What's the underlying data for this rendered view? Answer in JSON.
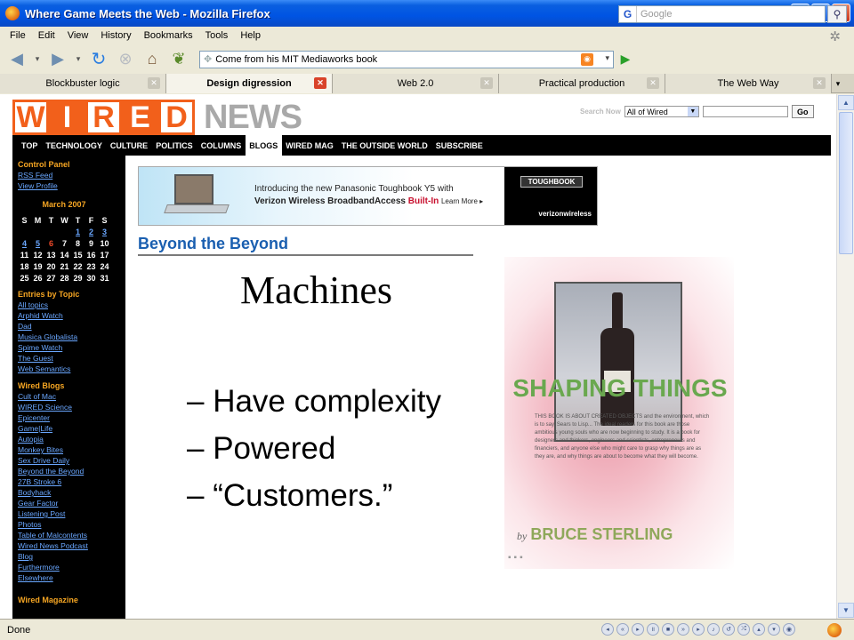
{
  "window": {
    "title": "Where Game Meets the Web - Mozilla Firefox"
  },
  "menu": {
    "items": [
      "File",
      "Edit",
      "View",
      "History",
      "Bookmarks",
      "Tools",
      "Help"
    ]
  },
  "toolbar": {
    "url": "Come from his MIT Mediaworks book",
    "search_placeholder": "Google"
  },
  "tabs": [
    {
      "label": "Blockbuster logic",
      "active": false
    },
    {
      "label": "Design digression",
      "active": true
    },
    {
      "label": "Web 2.0",
      "active": false
    },
    {
      "label": "Practical production",
      "active": false
    },
    {
      "label": "The Web Way",
      "active": false
    }
  ],
  "wired": {
    "logo_letters": [
      "W",
      "I",
      "R",
      "E",
      "D"
    ],
    "logo_news": "NEWS",
    "search_label": "Search Now",
    "search_scope": "All of Wired",
    "search_go": "Go",
    "nav": [
      "TOP",
      "TECHNOLOGY",
      "CULTURE",
      "POLITICS",
      "COLUMNS",
      "BLOGS",
      "WIRED MAG",
      "THE OUTSIDE WORLD",
      "SUBSCRIBE"
    ],
    "nav_active": "BLOGS"
  },
  "sidebar": {
    "control_panel": {
      "heading": "Control Panel",
      "links": [
        "RSS Feed",
        "View Profile"
      ]
    },
    "calendar": {
      "month": "March 2007",
      "weekdays": [
        "S",
        "M",
        "T",
        "W",
        "T",
        "F",
        "S"
      ],
      "weeks": [
        [
          "",
          "",
          "",
          "",
          "1",
          "2",
          "3"
        ],
        [
          "4",
          "5",
          "6",
          "7",
          "8",
          "9",
          "10"
        ],
        [
          "11",
          "12",
          "13",
          "14",
          "15",
          "16",
          "17"
        ],
        [
          "18",
          "19",
          "20",
          "21",
          "22",
          "23",
          "24"
        ],
        [
          "25",
          "26",
          "27",
          "28",
          "29",
          "30",
          "31"
        ]
      ],
      "linked_days": [
        "1",
        "2",
        "3",
        "4",
        "5"
      ],
      "today": "6"
    },
    "entries": {
      "heading": "Entries by Topic",
      "links": [
        "All topics",
        "Arphid Watch",
        "Dad",
        "Musica Globalista",
        "Spime Watch",
        "The Guest",
        "Web Semantics"
      ]
    },
    "blogs": {
      "heading": "Wired Blogs",
      "links": [
        "Cult of Mac",
        "WIRED Science",
        "Epicenter",
        "Game|Life",
        "Autopia",
        "Monkey Bites",
        "Sex Drive Daily",
        "Beyond the Beyond",
        "27B Stroke 6",
        "Bodyhack",
        "Gear Factor",
        "Listening Post",
        "Photos",
        "Table of Malcontents",
        "Wired News Podcast",
        "Blog",
        "Furthermore",
        "Elsewhere"
      ]
    },
    "magazine": {
      "heading": "Wired Magazine"
    }
  },
  "ad": {
    "line1_a": "Introducing the new ",
    "line1_b": "Panasonic Toughbook Y5 with",
    "line2_a": "Verizon Wireless BroadbandAccess ",
    "line2_b": "Built-In",
    "learn_more": "Learn More ▸",
    "brand": "TOUGHBOOK",
    "carrier": "verizonwireless"
  },
  "blog_title": "Beyond the Beyond",
  "slide": {
    "title": "Machines",
    "bullets": [
      "– Have complexity",
      "– Powered",
      "– “Customers.”"
    ]
  },
  "book": {
    "title": "SHAPING THINGS",
    "blurb": "THIS BOOK IS ABOUT CREATED OBJECTS and the environment, which is to say, Sears to Lisp... The ideal readers for this book are those ambitious young souls who are now beginning to study. It is a book for designers and thinkers, engineers and scientists, entrepreneurs and financiers, and anyone else who might care to grasp why things are as they are, and why things are about to become what they will become.",
    "by": "by",
    "author": "BRUCE STERLING"
  },
  "status": {
    "text": "Done"
  }
}
